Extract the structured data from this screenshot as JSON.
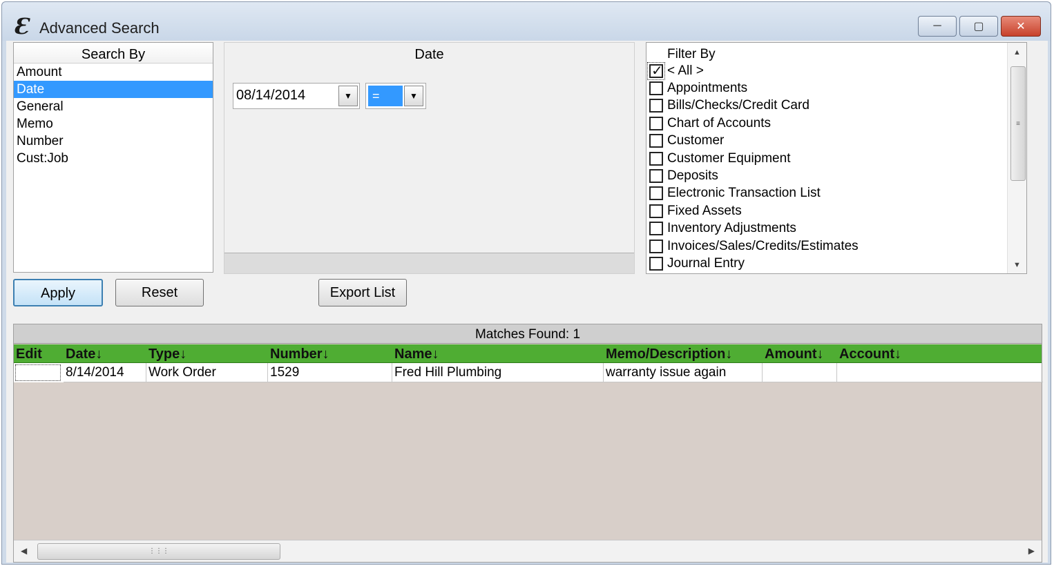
{
  "window": {
    "title": "Advanced Search",
    "logo_glyph": "Ɛ"
  },
  "search_by": {
    "header": "Search By",
    "items": [
      "Amount",
      "Date",
      "General",
      "Memo",
      "Number",
      "Cust:Job"
    ],
    "selected": "Date"
  },
  "date_panel": {
    "label": "Date",
    "date_value": "08/14/2014",
    "operator_value": "="
  },
  "filter_by": {
    "header": "Filter By",
    "items": [
      {
        "label": "< All >",
        "checked": true
      },
      {
        "label": "Appointments",
        "checked": false
      },
      {
        "label": "Bills/Checks/Credit Card",
        "checked": false
      },
      {
        "label": "Chart of Accounts",
        "checked": false
      },
      {
        "label": "Customer",
        "checked": false
      },
      {
        "label": "Customer Equipment",
        "checked": false
      },
      {
        "label": "Deposits",
        "checked": false
      },
      {
        "label": "Electronic Transaction List",
        "checked": false
      },
      {
        "label": "Fixed Assets",
        "checked": false
      },
      {
        "label": "Inventory Adjustments",
        "checked": false
      },
      {
        "label": "Invoices/Sales/Credits/Estimates",
        "checked": false
      },
      {
        "label": "Journal Entry",
        "checked": false
      }
    ]
  },
  "buttons": {
    "apply": "Apply",
    "reset": "Reset",
    "export": "Export List"
  },
  "results": {
    "matches_label": "Matches Found: 1",
    "columns": [
      "Edit",
      "Date↓",
      "Type↓",
      "Number↓",
      "Name↓",
      "Memo/Description↓",
      "Amount↓",
      "Account↓"
    ],
    "rows": [
      {
        "edit": "",
        "date": "8/14/2014",
        "type": "Work Order",
        "number": "1529",
        "name": "Fred Hill Plumbing",
        "memo": "warranty issue again",
        "amount": "",
        "account": ""
      }
    ]
  },
  "colors": {
    "selection": "#3399ff",
    "grid_header": "#4fad33",
    "grid_background": "#d8cfc9"
  }
}
